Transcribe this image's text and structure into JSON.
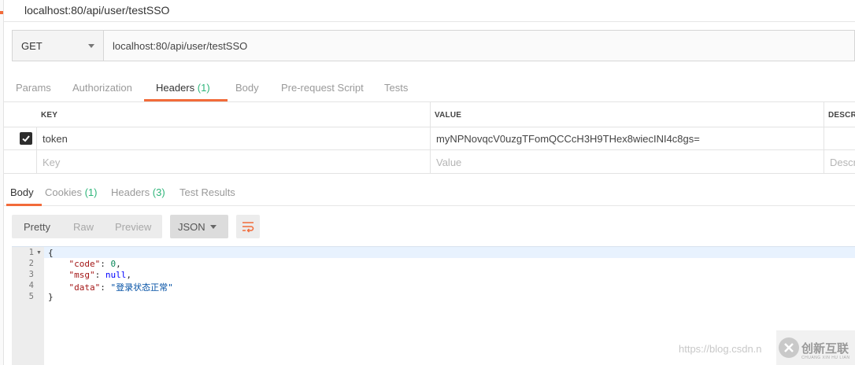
{
  "tab_title": "localhost:80/api/user/testSSO",
  "request": {
    "method": "GET",
    "url": "localhost:80/api/user/testSSO"
  },
  "request_tabs": [
    {
      "label": "Params",
      "count": ""
    },
    {
      "label": "Authorization",
      "count": ""
    },
    {
      "label": "Headers",
      "count": "(1)"
    },
    {
      "label": "Body",
      "count": ""
    },
    {
      "label": "Pre-request Script",
      "count": ""
    },
    {
      "label": "Tests",
      "count": ""
    }
  ],
  "active_request_tab": "Headers",
  "headers_table": {
    "columns": [
      "KEY",
      "VALUE",
      "DESCRI"
    ],
    "rows": [
      {
        "checked": true,
        "key": "token",
        "value": "myNPNovqcV0uzgTFomQCCcH3H9THex8wiecINI4c8gs="
      }
    ],
    "placeholders": {
      "key": "Key",
      "value": "Value",
      "description": "Descr"
    }
  },
  "response_tabs": [
    {
      "label": "Body",
      "count": ""
    },
    {
      "label": "Cookies",
      "count": "(1)"
    },
    {
      "label": "Headers",
      "count": "(3)"
    },
    {
      "label": "Test Results",
      "count": ""
    }
  ],
  "active_response_tab": "Body",
  "view_modes": [
    "Pretty",
    "Raw",
    "Preview"
  ],
  "active_view_mode": "Pretty",
  "format": "JSON",
  "response_body": {
    "line_numbers": [
      "1",
      "2",
      "3",
      "4",
      "5"
    ],
    "lines": [
      "{",
      "    \"code\": 0,",
      "    \"msg\": null,",
      "    \"data\": \"登录状态正常\"",
      "}"
    ],
    "code_key": "\"code\"",
    "code_value": "0",
    "msg_key": "\"msg\"",
    "msg_value": "null",
    "data_key": "\"data\"",
    "data_value": "\"登录状态正常\""
  },
  "watermark": {
    "url": "https://blog.csdn.n",
    "brand": "创新互联",
    "brand_pinyin": "CHUANG XIN HU LIAN"
  },
  "colors": {
    "accent": "#f26b3a",
    "count_green": "#2fb57a",
    "gutter": "#ededed"
  }
}
